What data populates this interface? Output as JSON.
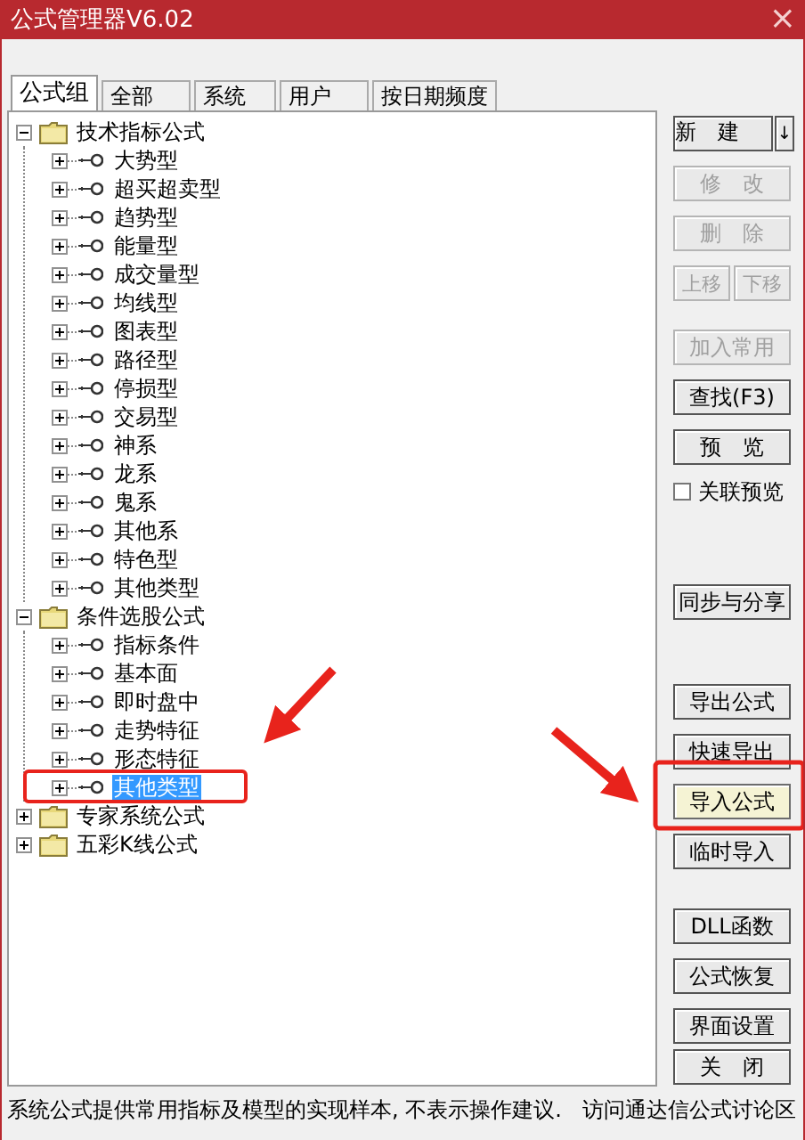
{
  "window": {
    "title": "公式管理器V6.02",
    "close": "×"
  },
  "tabs": [
    {
      "label": "公式组",
      "selected": true
    },
    {
      "label": "全部",
      "selected": false
    },
    {
      "label": "系统",
      "selected": false
    },
    {
      "label": "用户",
      "selected": false
    },
    {
      "label": "按日期频度",
      "selected": false
    }
  ],
  "tree": [
    {
      "label": "技术指标公式",
      "expanded": true,
      "selected": false,
      "children": [
        {
          "label": "大势型",
          "expanded": false,
          "selected": false
        },
        {
          "label": "超买超卖型",
          "expanded": false,
          "selected": false
        },
        {
          "label": "趋势型",
          "expanded": false,
          "selected": false
        },
        {
          "label": "能量型",
          "expanded": false,
          "selected": false
        },
        {
          "label": "成交量型",
          "expanded": false,
          "selected": false
        },
        {
          "label": "均线型",
          "expanded": false,
          "selected": false
        },
        {
          "label": "图表型",
          "expanded": false,
          "selected": false
        },
        {
          "label": "路径型",
          "expanded": false,
          "selected": false
        },
        {
          "label": "停损型",
          "expanded": false,
          "selected": false
        },
        {
          "label": "交易型",
          "expanded": false,
          "selected": false
        },
        {
          "label": "神系",
          "expanded": false,
          "selected": false
        },
        {
          "label": "龙系",
          "expanded": false,
          "selected": false
        },
        {
          "label": "鬼系",
          "expanded": false,
          "selected": false
        },
        {
          "label": "其他系",
          "expanded": false,
          "selected": false
        },
        {
          "label": "特色型",
          "expanded": false,
          "selected": false
        },
        {
          "label": "其他类型",
          "expanded": false,
          "selected": false
        }
      ]
    },
    {
      "label": "条件选股公式",
      "expanded": true,
      "selected": false,
      "children": [
        {
          "label": "指标条件",
          "expanded": false,
          "selected": false
        },
        {
          "label": "基本面",
          "expanded": false,
          "selected": false
        },
        {
          "label": "即时盘中",
          "expanded": false,
          "selected": false
        },
        {
          "label": "走势特征",
          "expanded": false,
          "selected": false
        },
        {
          "label": "形态特征",
          "expanded": false,
          "selected": false
        },
        {
          "label": "其他类型",
          "expanded": false,
          "selected": true
        }
      ]
    },
    {
      "label": "专家系统公式",
      "expanded": false,
      "selected": false
    },
    {
      "label": "五彩K线公式",
      "expanded": false,
      "selected": false
    }
  ],
  "button_groups": [
    [
      {
        "kind": "split",
        "label": "新　建",
        "arrow": "↓",
        "disabled": false,
        "focused": false
      },
      {
        "kind": "button",
        "label": "修　改",
        "disabled": true,
        "focused": false
      },
      {
        "kind": "button",
        "label": "删　除",
        "disabled": true,
        "focused": false
      },
      {
        "kind": "pair",
        "items": [
          {
            "label": "上移",
            "disabled": true
          },
          {
            "label": "下移",
            "disabled": true
          }
        ]
      }
    ],
    [
      {
        "kind": "button",
        "label": "加入常用",
        "disabled": true,
        "focused": false
      },
      {
        "kind": "button",
        "label": "查找(F3)",
        "disabled": false,
        "focused": false
      },
      {
        "kind": "button",
        "label": "预　览",
        "disabled": false,
        "focused": false
      },
      {
        "kind": "checkbox",
        "label": "关联预览",
        "checked": false
      }
    ],
    [
      {
        "kind": "button",
        "label": "同步与分享",
        "disabled": false,
        "focused": false
      }
    ],
    [
      {
        "kind": "button",
        "label": "导出公式",
        "disabled": false,
        "focused": false
      },
      {
        "kind": "button",
        "label": "快速导出",
        "disabled": false,
        "focused": false
      },
      {
        "kind": "button",
        "label": "导入公式",
        "disabled": false,
        "focused": true
      },
      {
        "kind": "button",
        "label": "临时导入",
        "disabled": false,
        "focused": false
      }
    ],
    [
      {
        "kind": "button",
        "label": "DLL函数",
        "disabled": false,
        "focused": false
      },
      {
        "kind": "button",
        "label": "公式恢复",
        "disabled": false,
        "focused": false
      },
      {
        "kind": "button",
        "label": "界面设置",
        "disabled": false,
        "focused": false
      }
    ],
    [
      {
        "kind": "button",
        "label": "关　闭",
        "disabled": false,
        "focused": false
      }
    ]
  ],
  "status_bar": {
    "text": "系统公式提供常用指标及模型的实现样本, 不表示操作建议.",
    "link": "访问通达信公式讨论区"
  }
}
